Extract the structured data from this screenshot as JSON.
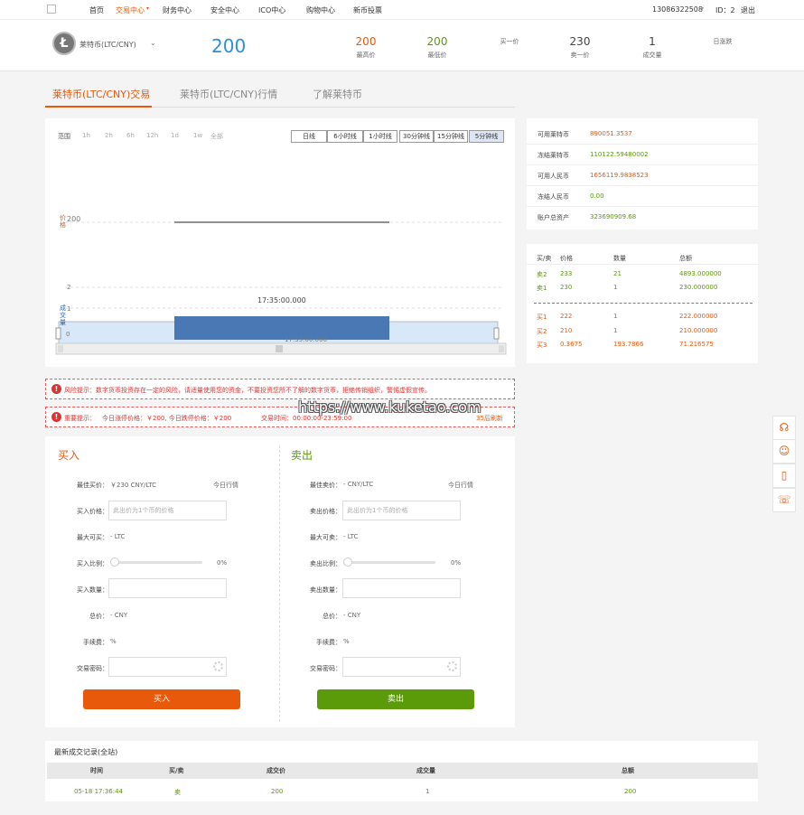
{
  "nav": {
    "items": [
      "首页",
      "交易中心",
      "财务中心",
      "安全中心",
      "ICO中心",
      "购物中心",
      "新币投票"
    ],
    "phone": "13086322508",
    "user_id": "ID：2",
    "logout": "退出"
  },
  "header": {
    "coin_name": "莱特币(LTC/CNY)",
    "coin_symbol": "Ł",
    "price": "200",
    "stats": [
      {
        "value": "200",
        "label": "最高价"
      },
      {
        "value": "200",
        "label": "最低价"
      },
      {
        "value": "",
        "label": "买一价"
      },
      {
        "value": "230",
        "label": "卖一价"
      },
      {
        "value": "1",
        "label": "成交量"
      },
      {
        "value": "",
        "label": "日涨跌"
      }
    ]
  },
  "tabs": [
    "莱特币(LTC/CNY)交易",
    "莱特币(LTC/CNY)行情",
    "了解莱特币"
  ],
  "chart": {
    "range_label": "范围",
    "ranges": [
      "1h",
      "2h",
      "6h",
      "12h",
      "1d",
      "1w",
      "全部"
    ],
    "timeframes": [
      "日线",
      "6小时线",
      "1小时线",
      "30分钟线",
      "15分钟线",
      "5分钟线"
    ],
    "selected_timeframe": "5分钟线",
    "price_axis_label": "价格",
    "volume_axis_label": "成交量",
    "tooltip_time": "17:35:00.000",
    "navigator_label": "17:35:00.000"
  },
  "chart_data": {
    "type": "line",
    "x": [
      "17:35:00.000"
    ],
    "series": [
      {
        "values": [
          200
        ]
      }
    ],
    "volume": [
      1
    ],
    "yticks": [
      "200",
      "2"
    ],
    "volume_ticks": [
      "1",
      "0"
    ],
    "grid": true
  },
  "assets": [
    {
      "label": "可用莱特币",
      "value": "890051.3537",
      "color": "#e8590c"
    },
    {
      "label": "冻结莱特币",
      "value": "110122.59480002",
      "color": "#5b9a08"
    },
    {
      "label": "可用人民币",
      "value": "1656119.9838523",
      "color": "#e8590c"
    },
    {
      "label": "冻结人民币",
      "value": "0.00",
      "color": "#5b9a08"
    },
    {
      "label": "账户总资产",
      "value": "323690909.68",
      "color": "#5b9a08"
    }
  ],
  "orderbook": {
    "headers": [
      "买/卖",
      "价格",
      "数量",
      "总额"
    ],
    "asks": [
      {
        "side": "卖2",
        "price": "233",
        "amount": "21",
        "total": "4893.000000"
      },
      {
        "side": "卖1",
        "price": "230",
        "amount": "1",
        "total": "230.000000"
      }
    ],
    "bids": [
      {
        "side": "买1",
        "price": "222",
        "amount": "1",
        "total": "222.000000"
      },
      {
        "side": "买2",
        "price": "210",
        "amount": "1",
        "total": "210.000000"
      },
      {
        "side": "买3",
        "price": "0.3675",
        "amount": "193.7866",
        "total": "71.216575"
      }
    ]
  },
  "warnings": {
    "risk": "风险提示：数字货币投资存在一定的风险，请适量使用您的资金，不要投资您所不了解的数字货币，拒绝传销组织，警惕虚假宣传。",
    "notice_prefix": "重要提示：",
    "notice_prices": "今日涨停价格：￥200, 今日跌停价格：￥200",
    "notice_time": "交易时间：00:00:00-23:59:00",
    "countdown": "35后刷新"
  },
  "buy": {
    "title": "买入",
    "best_label": "最佳买价：",
    "best_value": "￥230 CNY/LTC",
    "today_link": "今日行情",
    "price_label": "买入价格：",
    "price_placeholder": "此出价为1个币的价格",
    "max_label": "最大可买：",
    "max_value": "- LTC",
    "ratio_label": "买入比例：",
    "ratio_value": "0%",
    "amount_label": "买入数量：",
    "total_label": "总价：",
    "total_value": "- CNY",
    "fee_label": "手续费：",
    "fee_value": "%",
    "pwd_label": "交易密码：",
    "button": "买入"
  },
  "sell": {
    "title": "卖出",
    "best_label": "最佳卖价：",
    "best_value": "- CNY/LTC",
    "today_link": "今日行情",
    "price_label": "卖出价格：",
    "price_placeholder": "此出价为1个币的价格",
    "max_label": "最大可卖：",
    "max_value": "- LTC",
    "ratio_label": "卖出比例：",
    "ratio_value": "0%",
    "amount_label": "卖出数量：",
    "total_label": "总价：",
    "total_value": "- CNY",
    "fee_label": "手续费：",
    "fee_value": "%",
    "pwd_label": "交易密码：",
    "button": "卖出"
  },
  "records": {
    "title": "最新成交记录(全站)",
    "headers": [
      "时间",
      "买/卖",
      "成交价",
      "成交量",
      "总额"
    ],
    "rows": [
      {
        "time": "05-18 17:36:44",
        "side": "卖",
        "price": "200",
        "amount": "1",
        "total": "200"
      }
    ]
  },
  "watermark": "https://www.kuketao.com",
  "colors": {
    "accent": "#e8590c",
    "green": "#5b9a08",
    "buy_button": "#e8590c",
    "sell_button": "#5b9a08"
  }
}
